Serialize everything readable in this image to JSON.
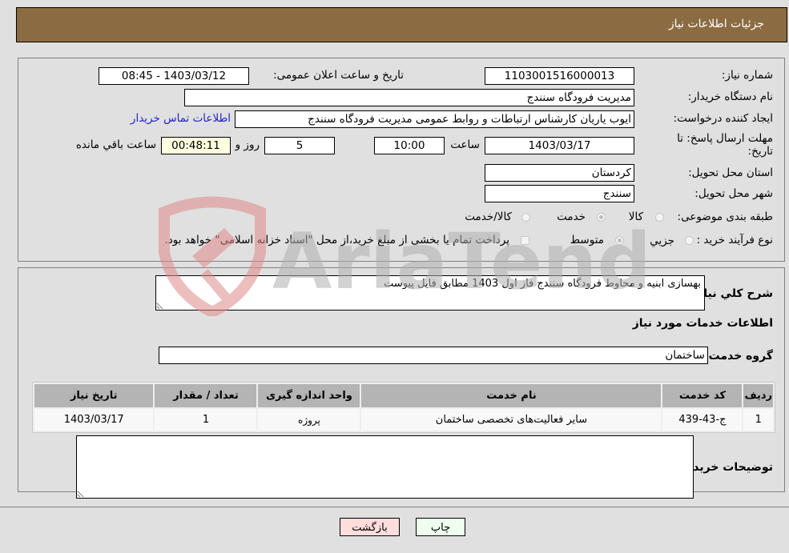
{
  "header": {
    "title": "جزئیات اطلاعات نیاز"
  },
  "details": {
    "need_number_label": "شماره نیاز:",
    "need_number": "1103001516000013",
    "announce_label": "تاریخ و ساعت اعلان عمومی:",
    "announce_value": "1403/03/12 - 08:45",
    "buyer_org_label": "نام دستگاه خریدار:",
    "buyer_org": "مدیریت فرودگاه سنندج",
    "creator_label": "ایجاد کننده درخواست:",
    "creator": "ایوب یاریان کارشناس ارتباطات و روابط عمومی مدیریت فرودگاه سنندج",
    "contact_link": "اطلاعات تماس خریدار",
    "deadline_label_line1": "مهلت ارسال پاسخ: تا",
    "deadline_label_line2": "تاریخ:",
    "deadline_date": "1403/03/17",
    "time_label": "ساعت",
    "deadline_time": "10:00",
    "days_value": "5",
    "days_label": "روز و",
    "remaining_time": "00:48:11",
    "remaining_label": "ساعت باقي مانده",
    "province_label": "استان محل تحویل:",
    "province": "کردستان",
    "city_label": "شهر محل تحویل:",
    "city": "سنندج",
    "category_label": "طبقه بندی موضوعی:",
    "category_options": [
      {
        "label": "کالا",
        "checked": false
      },
      {
        "label": "خدمت",
        "checked": true
      },
      {
        "label": "کالا/خدمت",
        "checked": false
      }
    ],
    "process_label": "نوع فرآیند خرید :",
    "process_options": [
      {
        "label": "جزيي",
        "checked": false
      },
      {
        "label": "متوسط",
        "checked": true
      }
    ],
    "treasury_note": "پرداخت تمام یا بخشی از مبلغ خرید،از محل \"اسناد خزانه اسلامی\" خواهد بود."
  },
  "summary": {
    "description_label": "شرح کلي نیاز:",
    "description": "بهسازی ابنیه و محاوط فرودگاه سنندج فاز اول 1403 مطابق فایل پیوست",
    "services_heading": "اطلاعات خدمات مورد نیاز",
    "service_group_label": "گروه خدمت:",
    "service_group": "ساختمان",
    "table": {
      "headers": [
        "ردیف",
        "کد خدمت",
        "نام خدمت",
        "واحد اندازه گیری",
        "تعداد / مقدار",
        "تاریخ نیاز"
      ],
      "rows": [
        [
          "1",
          "ج-43-439",
          "سایر فعالیت‌های تخصصی ساختمان",
          "پروژه",
          "1",
          "1403/03/17"
        ]
      ]
    },
    "buyer_notes_label": "توضیحات خریدار:",
    "buyer_notes": ""
  },
  "buttons": {
    "print": "چاپ",
    "back": "بازگشت"
  },
  "watermark": {
    "text": "AriaTender.neT"
  },
  "colors": {
    "header_bg": "#8b6c42",
    "print_bg": "#eeffee",
    "back_bg": "#ffdddd",
    "link": "#2222cc"
  }
}
